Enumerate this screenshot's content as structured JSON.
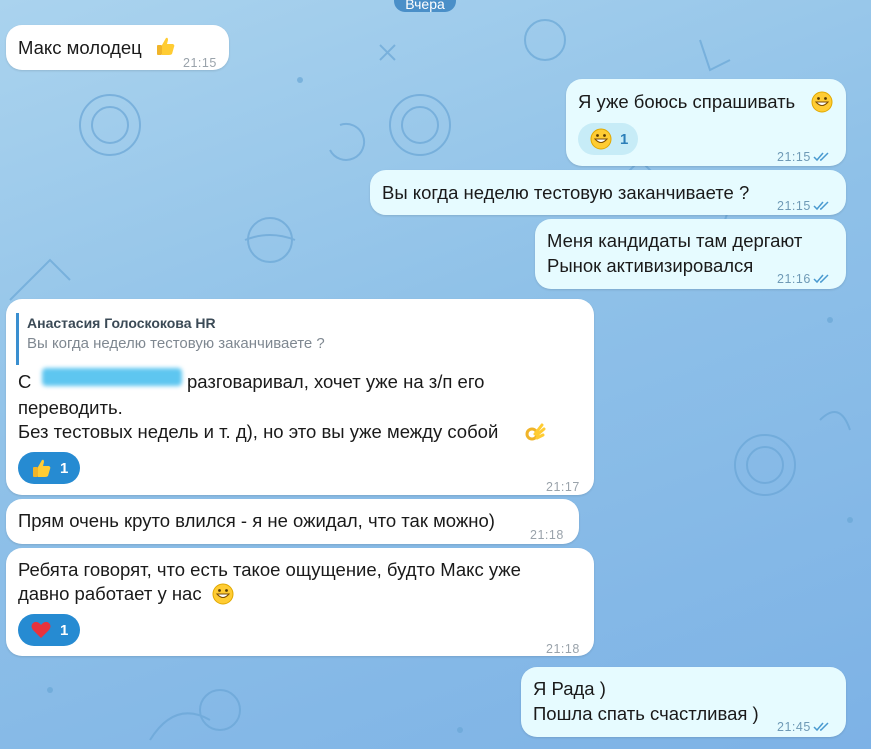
{
  "colors": {
    "background": "#8fc1e8",
    "incoming_bubble": "#ffffff",
    "outgoing_bubble": "#e6fbff",
    "accent": "#268bd2"
  },
  "date_label": "Вчера",
  "messages": [
    {
      "text": "Макс молодец",
      "emoji": "thumbs-up",
      "time": "21:15"
    },
    {
      "text": "Я уже боюсь спрашивать",
      "emoji": "grinning-face",
      "reaction": {
        "emoji": "grinning-face",
        "count": "1"
      },
      "time": "21:15",
      "status": "read"
    },
    {
      "text": "Вы когда неделю тестовую заканчиваете ?",
      "time": "21:15",
      "status": "read"
    },
    {
      "line1": "Меня кандидаты там дергают",
      "line2": "Рынок активизировался",
      "time": "21:16",
      "status": "read"
    },
    {
      "reply_author": "Анастасия Голоскокова HR",
      "reply_text": "Вы когда неделю тестовую заканчиваете ?",
      "line1_start": "С",
      "line1_end": "разговаривал, хочет уже на з/п его",
      "line2": "переводить.",
      "line3": "Без тестовых недель и т. д), но это вы уже между собой",
      "emoji": "ok-hand",
      "reaction": {
        "emoji": "thumbs-up",
        "count": "1"
      },
      "time": "21:17"
    },
    {
      "text": "Прям очень круто влился - я не ожидал, что так можно)",
      "time": "21:18"
    },
    {
      "line1": "Ребята говорят, что есть такое ощущение, будто Макс уже",
      "line2": "давно работает у нас",
      "emoji": "grinning-face",
      "reaction": {
        "emoji": "red-heart",
        "count": "1"
      },
      "time": "21:18"
    },
    {
      "line1": "Я Рада )",
      "line2": "Пошла спать счастливая )",
      "time": "21:45",
      "status": "read"
    }
  ]
}
